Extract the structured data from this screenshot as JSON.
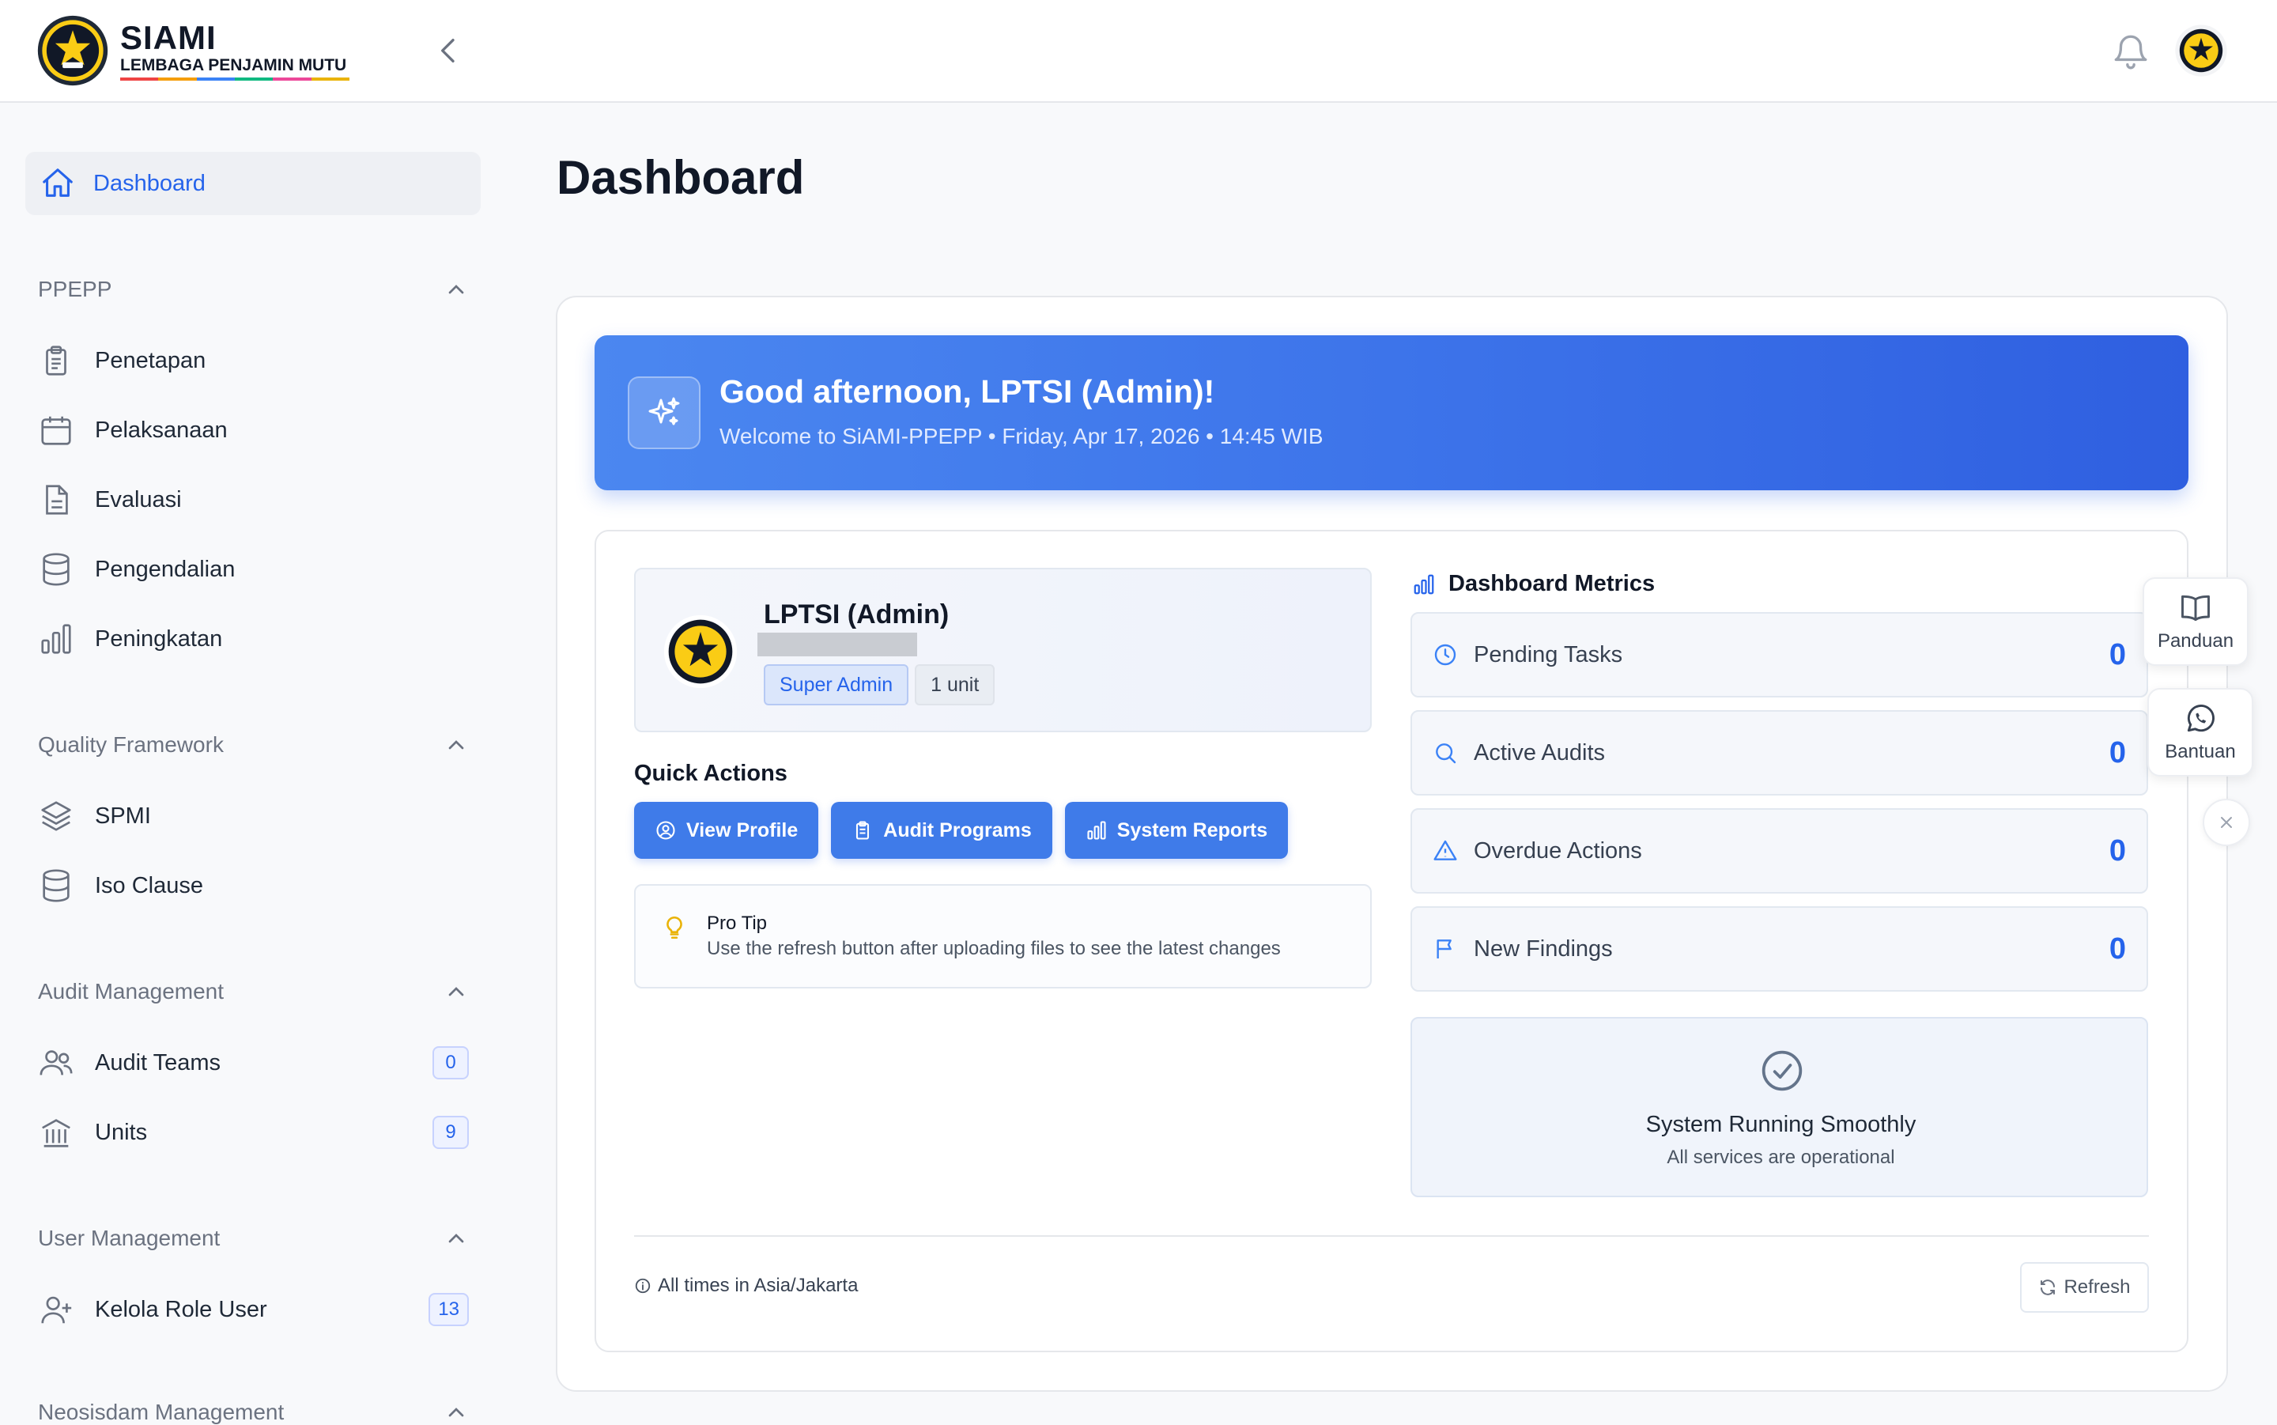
{
  "brand": {
    "title": "SIAMI",
    "subtitle": "LEMBAGA PENJAMIN MUTU",
    "stripe_colors": [
      "#ef4444",
      "#f59e0b",
      "#3b82f6",
      "#10b981",
      "#ec4899",
      "#eab308"
    ]
  },
  "sidebar": {
    "active": {
      "label": "Dashboard",
      "icon": "home-icon"
    },
    "sections": [
      {
        "title": "PPEPP",
        "items": [
          {
            "label": "Penetapan",
            "icon": "clipboard-icon"
          },
          {
            "label": "Pelaksanaan",
            "icon": "calendar-icon"
          },
          {
            "label": "Evaluasi",
            "icon": "document-icon"
          },
          {
            "label": "Pengendalian",
            "icon": "database-icon"
          },
          {
            "label": "Peningkatan",
            "icon": "bar-chart-icon"
          }
        ]
      },
      {
        "title": "Quality Framework",
        "items": [
          {
            "label": "SPMI",
            "icon": "layers-icon"
          },
          {
            "label": "Iso Clause",
            "icon": "database-icon"
          }
        ]
      },
      {
        "title": "Audit Management",
        "items": [
          {
            "label": "Audit Teams",
            "icon": "users-icon",
            "badge": "0"
          },
          {
            "label": "Units",
            "icon": "building-icon",
            "badge": "9"
          }
        ]
      },
      {
        "title": "User Management",
        "items": [
          {
            "label": "Kelola Role User",
            "icon": "user-plus-icon",
            "badge": "13"
          }
        ]
      },
      {
        "title": "Neosisdam Management",
        "items": []
      }
    ]
  },
  "page": {
    "title": "Dashboard"
  },
  "banner": {
    "greeting": "Good afternoon, LPTSI (Admin)!",
    "subtitle": "Welcome to SiAMI-PPEPP • Friday, Apr 17, 2026 • 14:45 WIB",
    "icon": "sparkles-icon"
  },
  "profile": {
    "name": "LPTSI (Admin)",
    "role": "Super Admin",
    "units": "1 unit"
  },
  "quick_actions": {
    "title": "Quick Actions",
    "buttons": [
      {
        "label": "View Profile",
        "icon": "user-circle-icon"
      },
      {
        "label": "Audit Programs",
        "icon": "clipboard-icon"
      },
      {
        "label": "System Reports",
        "icon": "bar-chart-icon"
      }
    ]
  },
  "tip": {
    "title": "Pro Tip",
    "text": "Use the refresh button after uploading files to see the latest changes"
  },
  "metrics": {
    "title": "Dashboard Metrics",
    "items": [
      {
        "label": "Pending Tasks",
        "value": "0",
        "icon": "clock-icon"
      },
      {
        "label": "Active Audits",
        "value": "0",
        "icon": "search-icon"
      },
      {
        "label": "Overdue Actions",
        "value": "0",
        "icon": "warning-icon"
      },
      {
        "label": "New Findings",
        "value": "0",
        "icon": "flag-icon"
      }
    ]
  },
  "status": {
    "title": "System Running Smoothly",
    "subtitle": "All services are operational"
  },
  "footer": {
    "timezone": "All times in Asia/Jakarta",
    "refresh_label": "Refresh"
  },
  "floating": {
    "guide_label": "Panduan",
    "help_label": "Bantuan"
  },
  "colors": {
    "accent": "#2563eb",
    "banner_start": "#4b87f0",
    "banner_end": "#2f5fe0"
  }
}
